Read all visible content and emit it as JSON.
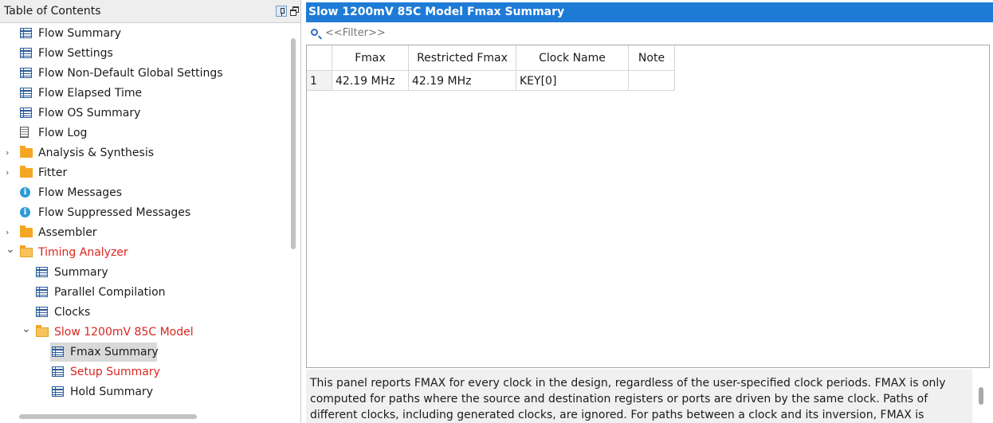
{
  "toc": {
    "title": "Table of Contents",
    "items": [
      {
        "label": "Flow Summary",
        "icon": "table-icon"
      },
      {
        "label": "Flow Settings",
        "icon": "table-icon"
      },
      {
        "label": "Flow Non-Default Global Settings",
        "icon": "table-icon"
      },
      {
        "label": "Flow Elapsed Time",
        "icon": "table-icon"
      },
      {
        "label": "Flow OS Summary",
        "icon": "table-icon"
      },
      {
        "label": "Flow Log",
        "icon": "log-icon"
      },
      {
        "label": "Analysis & Synthesis",
        "icon": "folder-icon",
        "expandable": "collapsed"
      },
      {
        "label": "Fitter",
        "icon": "folder-icon",
        "expandable": "collapsed"
      },
      {
        "label": "Flow Messages",
        "icon": "info-icon"
      },
      {
        "label": "Flow Suppressed Messages",
        "icon": "info-icon"
      },
      {
        "label": "Assembler",
        "icon": "folder-icon",
        "expandable": "collapsed"
      },
      {
        "label": "Timing Analyzer",
        "icon": "folder-open-icon",
        "expandable": "expanded",
        "color": "#d9251d"
      },
      {
        "label": "Summary",
        "icon": "table-icon"
      },
      {
        "label": "Parallel Compilation",
        "icon": "table-icon"
      },
      {
        "label": "Clocks",
        "icon": "table-icon"
      },
      {
        "label": "Slow 1200mV 85C Model",
        "icon": "folder-open-icon",
        "expandable": "expanded",
        "color": "#d9251d"
      },
      {
        "label": "Fmax Summary",
        "icon": "table-icon",
        "selected": true
      },
      {
        "label": "Setup Summary",
        "icon": "table-icon",
        "color": "#d9251d"
      },
      {
        "label": "Hold Summary",
        "icon": "table-icon"
      }
    ]
  },
  "report": {
    "title": "Slow 1200mV 85C Model Fmax Summary",
    "filter_placeholder": "<<Filter>>",
    "columns": [
      "",
      "Fmax",
      "Restricted Fmax",
      "Clock Name",
      "Note"
    ],
    "rows": [
      [
        "1",
        "42.19 MHz",
        "42.19 MHz",
        "KEY[0]",
        ""
      ]
    ],
    "description": "This panel reports FMAX for every clock in the design, regardless of the user-specified clock periods.  FMAX is only computed for paths where the source and destination registers or ports are driven by the same clock.  Paths of different clocks, including generated clocks, are ignored.  For paths between a clock and its inversion, FMAX is computed as if the"
  },
  "colors": {
    "accent": "#1e7bd6",
    "alert_red": "#d9251d",
    "selection": "#d9d9d9"
  }
}
